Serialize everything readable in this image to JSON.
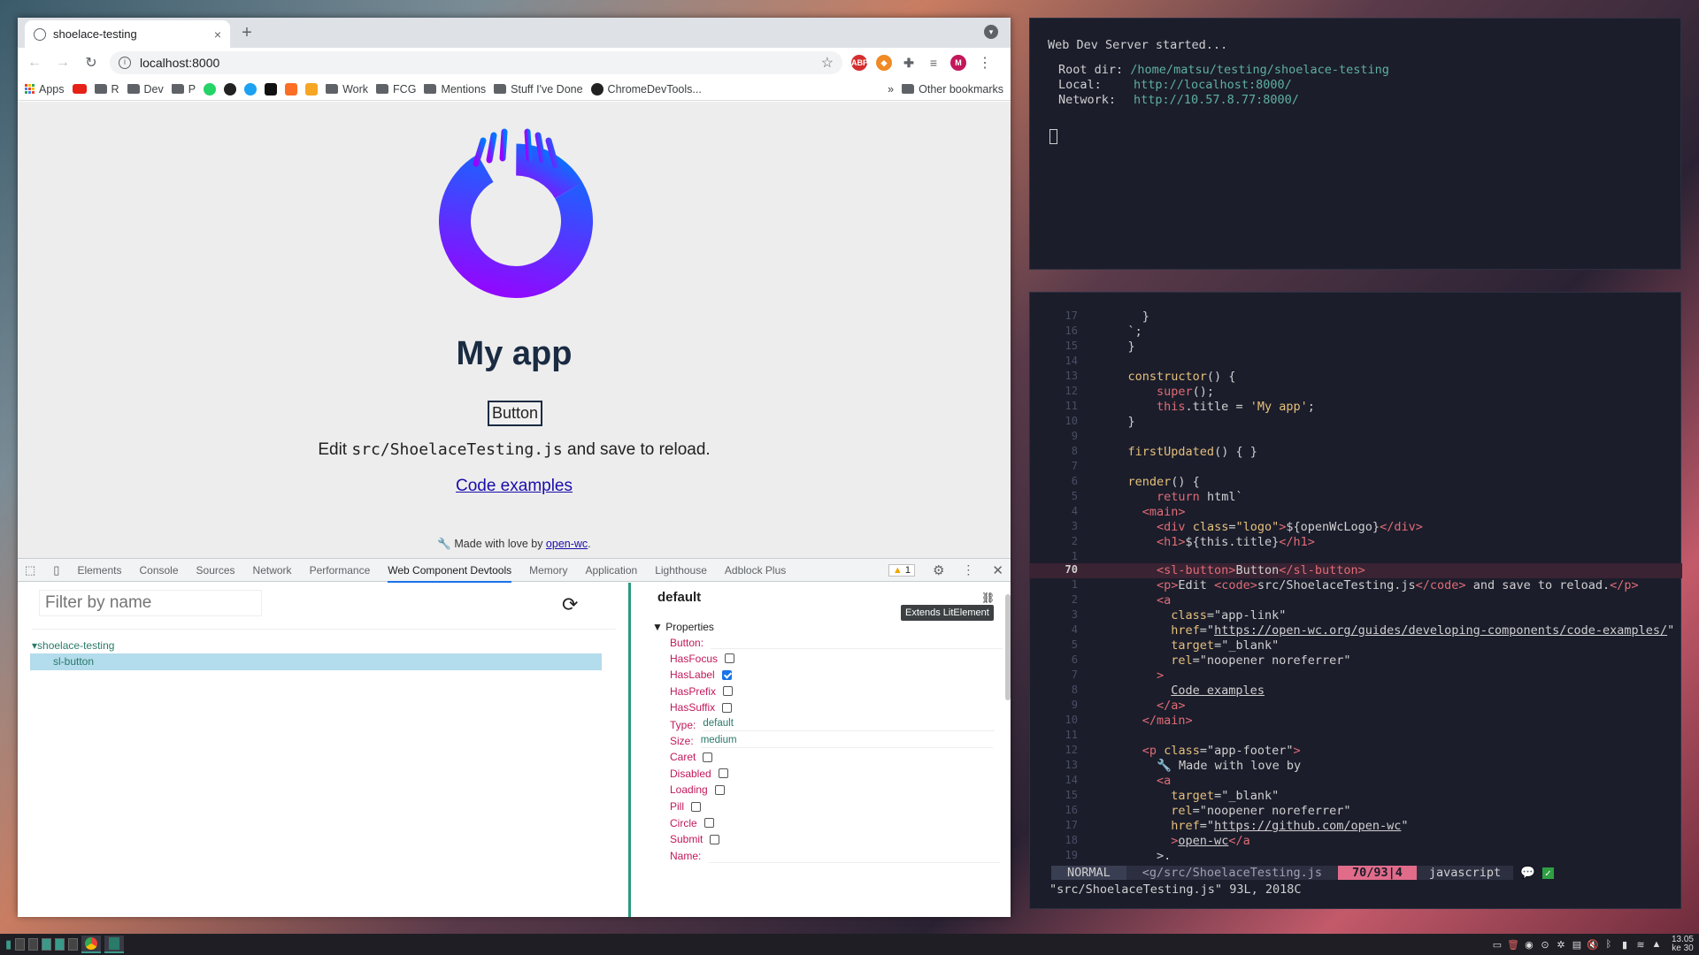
{
  "browser": {
    "tab_title": "shoelace-testing",
    "tab_close": "×",
    "new_tab": "+",
    "url": "localhost:8000",
    "ext_abp": "ABP",
    "avatar_letter": "M",
    "bookmarks": [
      "Apps",
      "R",
      "Dev",
      "P",
      "Work",
      "FCG",
      "Mentions",
      "Stuff I've Done",
      "ChromeDevTools..."
    ],
    "more": "»",
    "other_bookmarks": "Other bookmarks"
  },
  "page": {
    "title": "My app",
    "button_label": "Button",
    "edit_prefix": "Edit ",
    "edit_code": "src/ShoelaceTesting.js",
    "edit_suffix": " and save to reload.",
    "link_text": "Code examples",
    "footer_prefix": "Made with love by ",
    "footer_link": "open-wc",
    "footer_suffix": "."
  },
  "devtools": {
    "tabs": [
      "Elements",
      "Console",
      "Sources",
      "Network",
      "Performance",
      "Web Component Devtools",
      "Memory",
      "Application",
      "Lighthouse",
      "Adblock Plus"
    ],
    "active_tab": "Web Component Devtools",
    "warning_count": "1",
    "filter_placeholder": "Filter by name",
    "tree_root": "shoelace-testing",
    "tree_child": "sl-button",
    "panel_title": "default",
    "tooltip": "Extends LitElement",
    "properties_header": "Properties",
    "properties": [
      {
        "label": "Button:",
        "kind": "text",
        "value": ""
      },
      {
        "label": "HasFocus",
        "kind": "checkbox",
        "checked": false
      },
      {
        "label": "HasLabel",
        "kind": "checkbox",
        "checked": true
      },
      {
        "label": "HasPrefix",
        "kind": "checkbox",
        "checked": false
      },
      {
        "label": "HasSuffix",
        "kind": "checkbox",
        "checked": false
      },
      {
        "label": "Type:",
        "kind": "text",
        "value": "default"
      },
      {
        "label": "Size:",
        "kind": "text",
        "value": "medium"
      },
      {
        "label": "Caret",
        "kind": "checkbox",
        "checked": false
      },
      {
        "label": "Disabled",
        "kind": "checkbox",
        "checked": false
      },
      {
        "label": "Loading",
        "kind": "checkbox",
        "checked": false
      },
      {
        "label": "Pill",
        "kind": "checkbox",
        "checked": false
      },
      {
        "label": "Circle",
        "kind": "checkbox",
        "checked": false
      },
      {
        "label": "Submit",
        "kind": "checkbox",
        "checked": false
      },
      {
        "label": "Name:",
        "kind": "text",
        "value": ""
      }
    ]
  },
  "terminal1": {
    "line1": "Web Dev Server started...",
    "root_label": "Root dir:",
    "root_value": "/home/matsu/testing/shoelace-testing",
    "local_label": "Local:",
    "local_value": "http://localhost:8000/",
    "network_label": "Network:",
    "network_value": "http://10.57.8.77:8000/"
  },
  "editor": {
    "line_numbers": [
      "17",
      "16",
      "15",
      "14",
      "13",
      "12",
      "11",
      "10",
      "9",
      "8",
      "7",
      "6",
      "5",
      "4",
      "3",
      "2",
      "1",
      "70",
      "1",
      "2",
      "3",
      "4",
      "5",
      "6",
      "7",
      "8",
      "9",
      "10",
      "11",
      "12",
      "13",
      "14",
      "15",
      "16",
      "17",
      "18",
      "19"
    ],
    "status_mode": "NORMAL",
    "status_file": "<g/src/ShoelaceTesting.js",
    "status_pos": "70/93|4",
    "status_filetype": "javascript",
    "cmdline": "\"src/ShoelaceTesting.js\" 93L, 2018C"
  },
  "taskbar": {
    "clock_time": "13.05",
    "clock_date": "ke 30"
  },
  "colors": {
    "accent": "#1a73e8",
    "devtools_splitter": "#2a9a80",
    "terminal_bg": "#1b1d2b",
    "status_pos": "#e06c8a"
  }
}
